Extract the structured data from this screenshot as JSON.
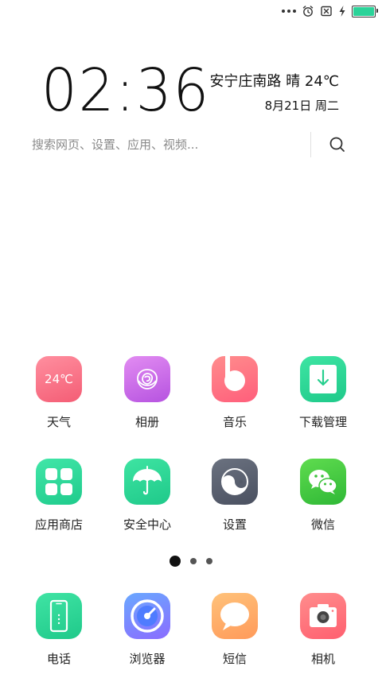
{
  "status_bar": {
    "icons": [
      "more-dots-icon",
      "alarm-icon",
      "sim-off-icon",
      "charging-icon",
      "battery-icon"
    ],
    "battery_color": "#2bd399"
  },
  "clock": {
    "time": "02:36",
    "location_weather": "安宁庄南路 晴 24℃",
    "date": "8月21日 周二"
  },
  "search": {
    "placeholder": "搜索网页、设置、应用、视频...",
    "icon": "search-icon"
  },
  "apps": {
    "weather": {
      "label": "天气",
      "icon_text": "24℃",
      "color": "#f7687e"
    },
    "gallery": {
      "label": "相册",
      "color": "#c966e6"
    },
    "music": {
      "label": "音乐",
      "color": "#ff6f82"
    },
    "downloads": {
      "label": "下载管理",
      "color": "#2fd797"
    },
    "store": {
      "label": "应用商店",
      "color": "#2fd797"
    },
    "security": {
      "label": "安全中心",
      "color": "#2fd797"
    },
    "settings": {
      "label": "设置",
      "color": "#5a606e"
    },
    "wechat": {
      "label": "微信",
      "color": "#47c93f"
    }
  },
  "pager": {
    "pages": 3,
    "active": 1
  },
  "dock": {
    "phone": {
      "label": "电话",
      "color": "#2fd797"
    },
    "browser": {
      "label": "浏览器",
      "color": "#7a8cff"
    },
    "sms": {
      "label": "短信",
      "color": "#ffae6a"
    },
    "camera": {
      "label": "相机",
      "color": "#ff7078"
    }
  }
}
